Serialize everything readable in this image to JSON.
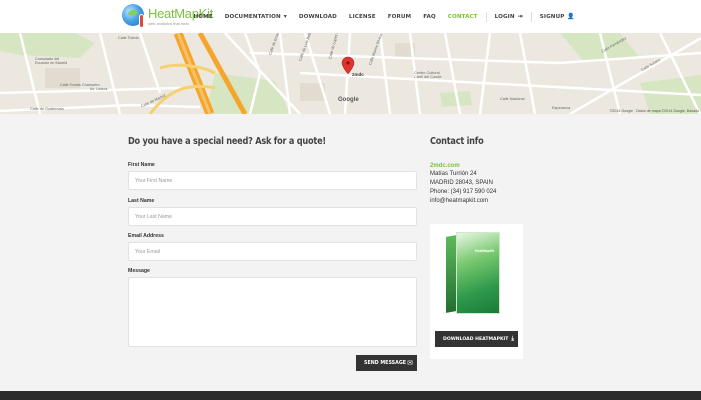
{
  "header": {
    "logo_title_a": "Heat",
    "logo_title_b": "MapKit",
    "logo_tagline": "web analytics that heat",
    "nav": [
      {
        "label": "HOME"
      },
      {
        "label": "DOCUMENTATION"
      },
      {
        "label": "DOWNLOAD"
      },
      {
        "label": "LICENSE"
      },
      {
        "label": "FORUM"
      },
      {
        "label": "FAQ"
      },
      {
        "label": "CONTACT"
      },
      {
        "label": "LOGIN"
      },
      {
        "label": "SIGNUP"
      }
    ],
    "active_nav": "CONTACT",
    "accent_color": "#7bbf3f"
  },
  "map": {
    "streets": [
      "Calle Toledo",
      "Calle de Ernesto Fernández",
      "Calle Tomás Chamartín",
      "Av. Lisboa",
      "Calle de Guatemala",
      "Calle de Madrid",
      "Calle de Luis Bello",
      "Calle Marino Rivera",
      "Centro Cultural Carril del Conde",
      "Calle Nacional",
      "Esperanza",
      "Calle Fernández",
      "Calle Solano",
      "Calle de Lopez de Hoyos",
      "Consulado del Ecuador en Madrid"
    ],
    "marker_label": "2mdc",
    "google_label": "Google",
    "copyright": "©2014 Google · Datos de mapa ©2014 Google, Basado"
  },
  "form": {
    "title": "Do you have a special need? Ask for a quote!",
    "first_name_label": "First Name",
    "first_name_placeholder": "Your First Name",
    "last_name_label": "Last Name",
    "last_name_placeholder": "Your Last Name",
    "email_label": "Email Address",
    "email_placeholder": "Your Email",
    "message_label": "Message",
    "message_value": "",
    "send_label": "SEND MESSAGE"
  },
  "contact": {
    "title": "Contact info",
    "company": "2mdc.com",
    "address_1": "Matías Turrión 24",
    "address_2": "MADRID 28043, SPAIN",
    "phone": "Phone: (34) 917 590 024",
    "email": "info@heatmapkit.com",
    "box_label": "HeatMapKit",
    "download_label": "DOWNLOAD HEATMAPKIT"
  }
}
